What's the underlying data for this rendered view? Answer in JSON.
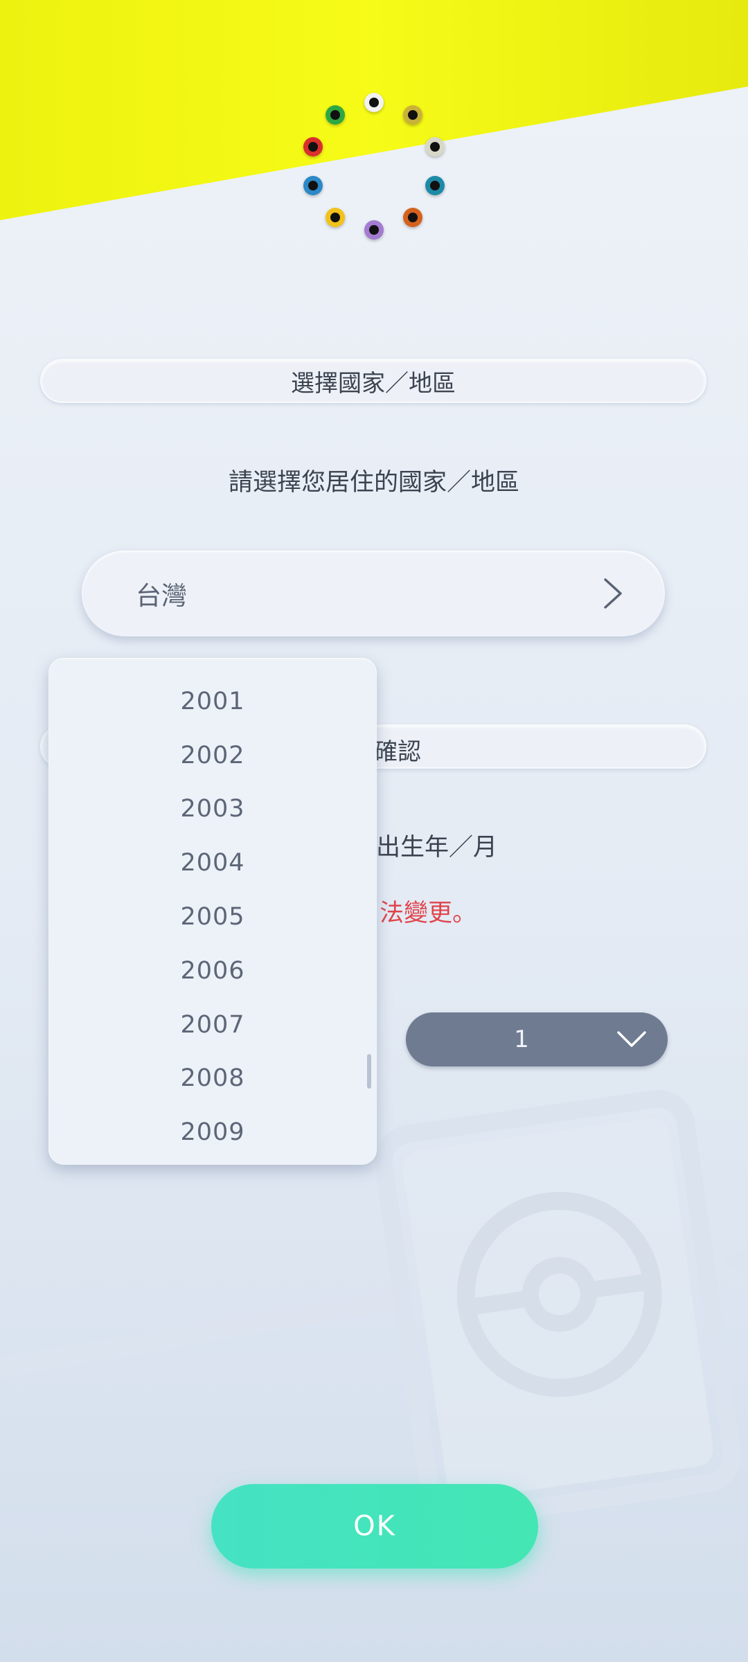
{
  "energies": [
    {
      "name": "colorless-energy-icon",
      "color": "#f2f2f2"
    },
    {
      "name": "dragon-energy-icon",
      "color": "#c9b23a"
    },
    {
      "name": "fairy-energy-icon",
      "color": "#d8d8c8"
    },
    {
      "name": "water-energy-icon",
      "color": "#1e8aa8"
    },
    {
      "name": "fighting-energy-icon",
      "color": "#d4621e"
    },
    {
      "name": "psychic-energy-icon",
      "color": "#a37bd1"
    },
    {
      "name": "lightning-energy-icon",
      "color": "#f2c21b"
    },
    {
      "name": "water-energy-icon-2",
      "color": "#2c88c6"
    },
    {
      "name": "fire-energy-icon",
      "color": "#d9302b"
    },
    {
      "name": "grass-energy-icon",
      "color": "#2ea843"
    }
  ],
  "country_section": {
    "title": "選擇國家／地區",
    "prompt": "請選擇您居住的國家／地區",
    "selected_country": "台灣"
  },
  "birth_section": {
    "title_visible": "確認",
    "prompt_visible": "出生年／月",
    "notice_visible": "法變更。",
    "month_value": "1"
  },
  "year_dropdown": {
    "options": [
      "2001",
      "2002",
      "2003",
      "2004",
      "2005",
      "2006",
      "2007",
      "2008",
      "2009"
    ]
  },
  "ok_button": {
    "label": "OK"
  },
  "colors": {
    "accent": "#45e2c4",
    "banner_yellow": "#f4f915",
    "warning": "#e0444c"
  }
}
